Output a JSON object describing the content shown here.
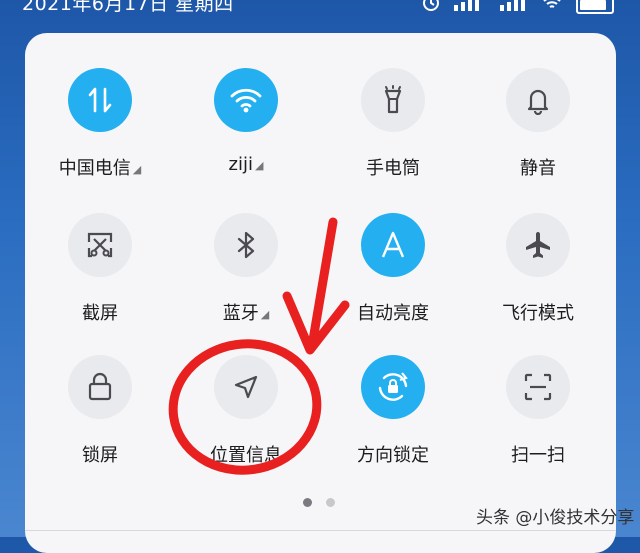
{
  "status_bar": {
    "time_text": "2021年6月17日 星期四"
  },
  "tiles": [
    {
      "label": "中国电信",
      "icon": "data-transfer-icon",
      "on": true,
      "has_menu": true
    },
    {
      "label": "ziji",
      "icon": "wifi-icon",
      "on": true,
      "has_menu": true
    },
    {
      "label": "手电筒",
      "icon": "flashlight-icon",
      "on": false,
      "has_menu": false
    },
    {
      "label": "静音",
      "icon": "bell-icon",
      "on": false,
      "has_menu": false
    },
    {
      "label": "截屏",
      "icon": "screenshot-scissors-icon",
      "on": false,
      "has_menu": false
    },
    {
      "label": "蓝牙",
      "icon": "bluetooth-icon",
      "on": false,
      "has_menu": true
    },
    {
      "label": "自动亮度",
      "icon": "auto-brightness-icon",
      "on": true,
      "has_menu": false
    },
    {
      "label": "飞行模式",
      "icon": "airplane-icon",
      "on": false,
      "has_menu": false
    },
    {
      "label": "锁屏",
      "icon": "lock-icon",
      "on": false,
      "has_menu": false
    },
    {
      "label": "位置信息",
      "icon": "location-arrow-icon",
      "on": false,
      "has_menu": false
    },
    {
      "label": "方向锁定",
      "icon": "rotation-lock-icon",
      "on": true,
      "has_menu": false
    },
    {
      "label": "扫一扫",
      "icon": "scan-icon",
      "on": false,
      "has_menu": false
    }
  ],
  "pagination": {
    "pages": 2,
    "current": 1
  },
  "watermark": "头条 @小俊技术分享",
  "colors": {
    "active": "#24b0f0",
    "inactive": "#e9eaee",
    "annotation": "#e8201f"
  }
}
